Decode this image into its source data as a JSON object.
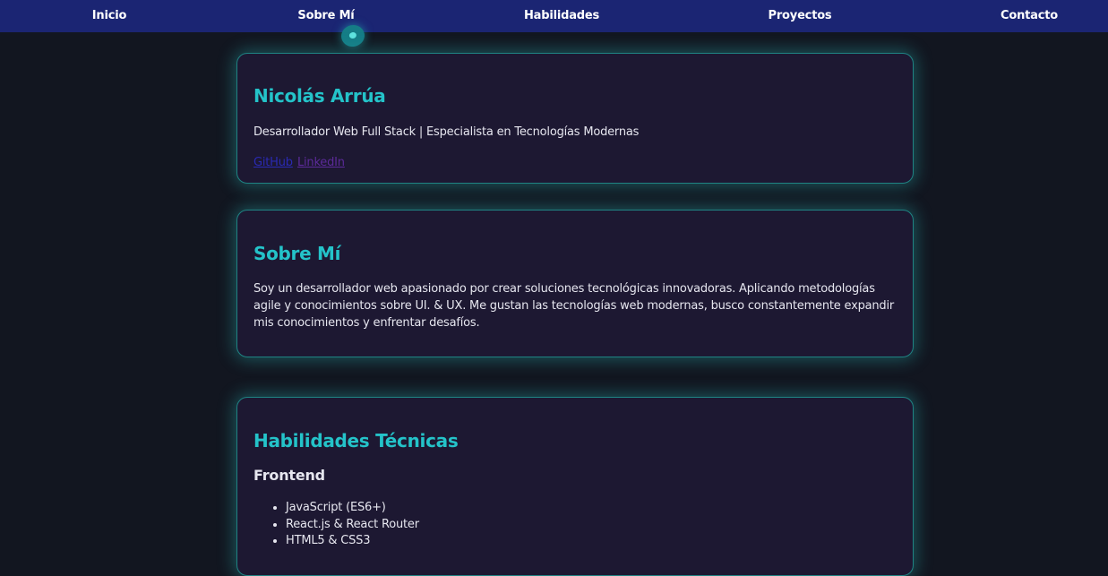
{
  "nav": {
    "items": [
      {
        "label": "Inicio"
      },
      {
        "label": "Sobre Mí"
      },
      {
        "label": "Habilidades"
      },
      {
        "label": "Proyectos"
      },
      {
        "label": "Contacto"
      }
    ],
    "active_index": 1,
    "indicator_color": "#157d86",
    "background": "#1b2573"
  },
  "profile": {
    "name": "Nicolás Arrúa",
    "tagline": "Desarrollador Web Full Stack | Especialista en Tecnologías Modernas",
    "links": {
      "github": "GitHub",
      "linkedin": "LinkedIn"
    }
  },
  "about": {
    "title": "Sobre Mí",
    "text": "Soy un desarrollador web apasionado por crear soluciones tecnológicas innovadoras. Aplicando metodologías agile y conocimientos sobre UI. & UX. Me gustan las tecnologías web modernas, busco constantemente expandir mis conocimientos y enfrentar desafíos."
  },
  "skills": {
    "title": "Habilidades Técnicas",
    "frontend": {
      "title": "Frontend",
      "items": [
        "JavaScript (ES6+)",
        "React.js & React Router",
        "HTML5 & CSS3"
      ]
    }
  },
  "colors": {
    "accent": "#24c3c9",
    "card_bg": "#1d1832",
    "page_bg": "#121620",
    "link_github": "#2a2ab3",
    "link_linkedin": "#5c2a9a"
  }
}
